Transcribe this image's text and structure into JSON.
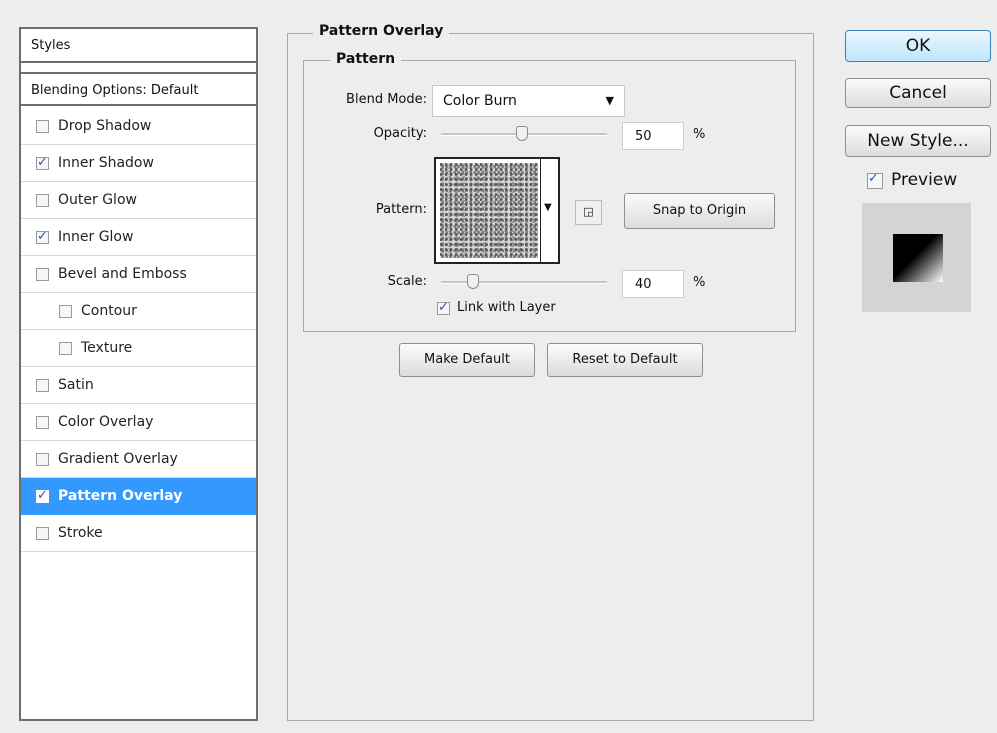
{
  "styles_list": {
    "header": "Styles",
    "blending_options": "Blending Options: Default",
    "items": [
      {
        "label": "Drop Shadow",
        "checked": false
      },
      {
        "label": "Inner Shadow",
        "checked": true
      },
      {
        "label": "Outer Glow",
        "checked": false
      },
      {
        "label": "Inner Glow",
        "checked": true
      },
      {
        "label": "Bevel and Emboss",
        "checked": false
      },
      {
        "label": "Contour",
        "checked": false
      },
      {
        "label": "Texture",
        "checked": false
      },
      {
        "label": "Satin",
        "checked": false
      },
      {
        "label": "Color Overlay",
        "checked": false
      },
      {
        "label": "Gradient Overlay",
        "checked": false
      },
      {
        "label": "Pattern Overlay",
        "checked": true,
        "selected": true
      },
      {
        "label": "Stroke",
        "checked": false
      }
    ]
  },
  "pattern_overlay": {
    "group_title": "Pattern Overlay",
    "sub_title": "Pattern",
    "blend_mode_label": "Blend Mode:",
    "blend_mode_value": "Color Burn",
    "opacity_label": "Opacity:",
    "opacity_value": "50",
    "opacity_unit": "%",
    "pattern_label": "Pattern:",
    "snap_button": "Snap to Origin",
    "scale_label": "Scale:",
    "scale_value": "40",
    "scale_unit": "%",
    "link_label": "Link with Layer",
    "link_checked": true,
    "make_default": "Make Default",
    "reset_default": "Reset to Default"
  },
  "dialog_buttons": {
    "ok": "OK",
    "cancel": "Cancel",
    "new_style": "New Style...",
    "preview_label": "Preview",
    "preview_checked": true
  },
  "colors": {
    "selection": "#3399ff",
    "background": "#ededed"
  }
}
